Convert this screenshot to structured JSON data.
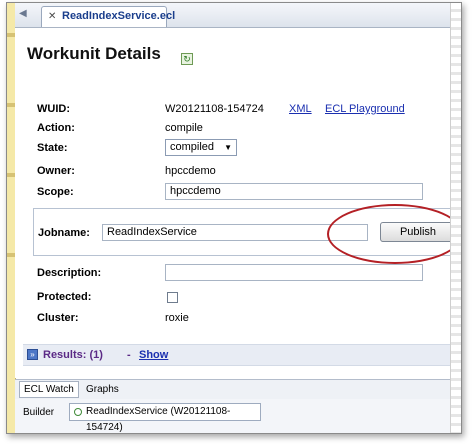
{
  "tab": {
    "title": "ReadIndexService.ecl"
  },
  "page": {
    "title": "Workunit Details"
  },
  "fields": {
    "wuid_label": "WUID:",
    "wuid_value": "W20121108-154724",
    "xml_link": "XML",
    "playground_link": "ECL Playground",
    "action_label": "Action:",
    "action_value": "compile",
    "state_label": "State:",
    "state_value": "compiled",
    "owner_label": "Owner:",
    "owner_value": "hpccdemo",
    "scope_label": "Scope:",
    "scope_value": "hpccdemo",
    "jobname_label": "Jobname:",
    "jobname_value": "ReadIndexService",
    "publish_button": "Publish",
    "description_label": "Description:",
    "description_value": "",
    "protected_label": "Protected:",
    "cluster_label": "Cluster:",
    "cluster_value": "roxie"
  },
  "results": {
    "label": "Results: (1)",
    "separator": "-",
    "show_link": "Show"
  },
  "bottom_tabs": [
    "ECL Watch",
    "Graphs"
  ],
  "builder": {
    "label": "Builder",
    "item": "ReadIndexService (W20121108-154724)"
  },
  "colors": {
    "highlight": "#b42025",
    "link": "#1a2fb0",
    "results_text": "#5b2a86"
  }
}
